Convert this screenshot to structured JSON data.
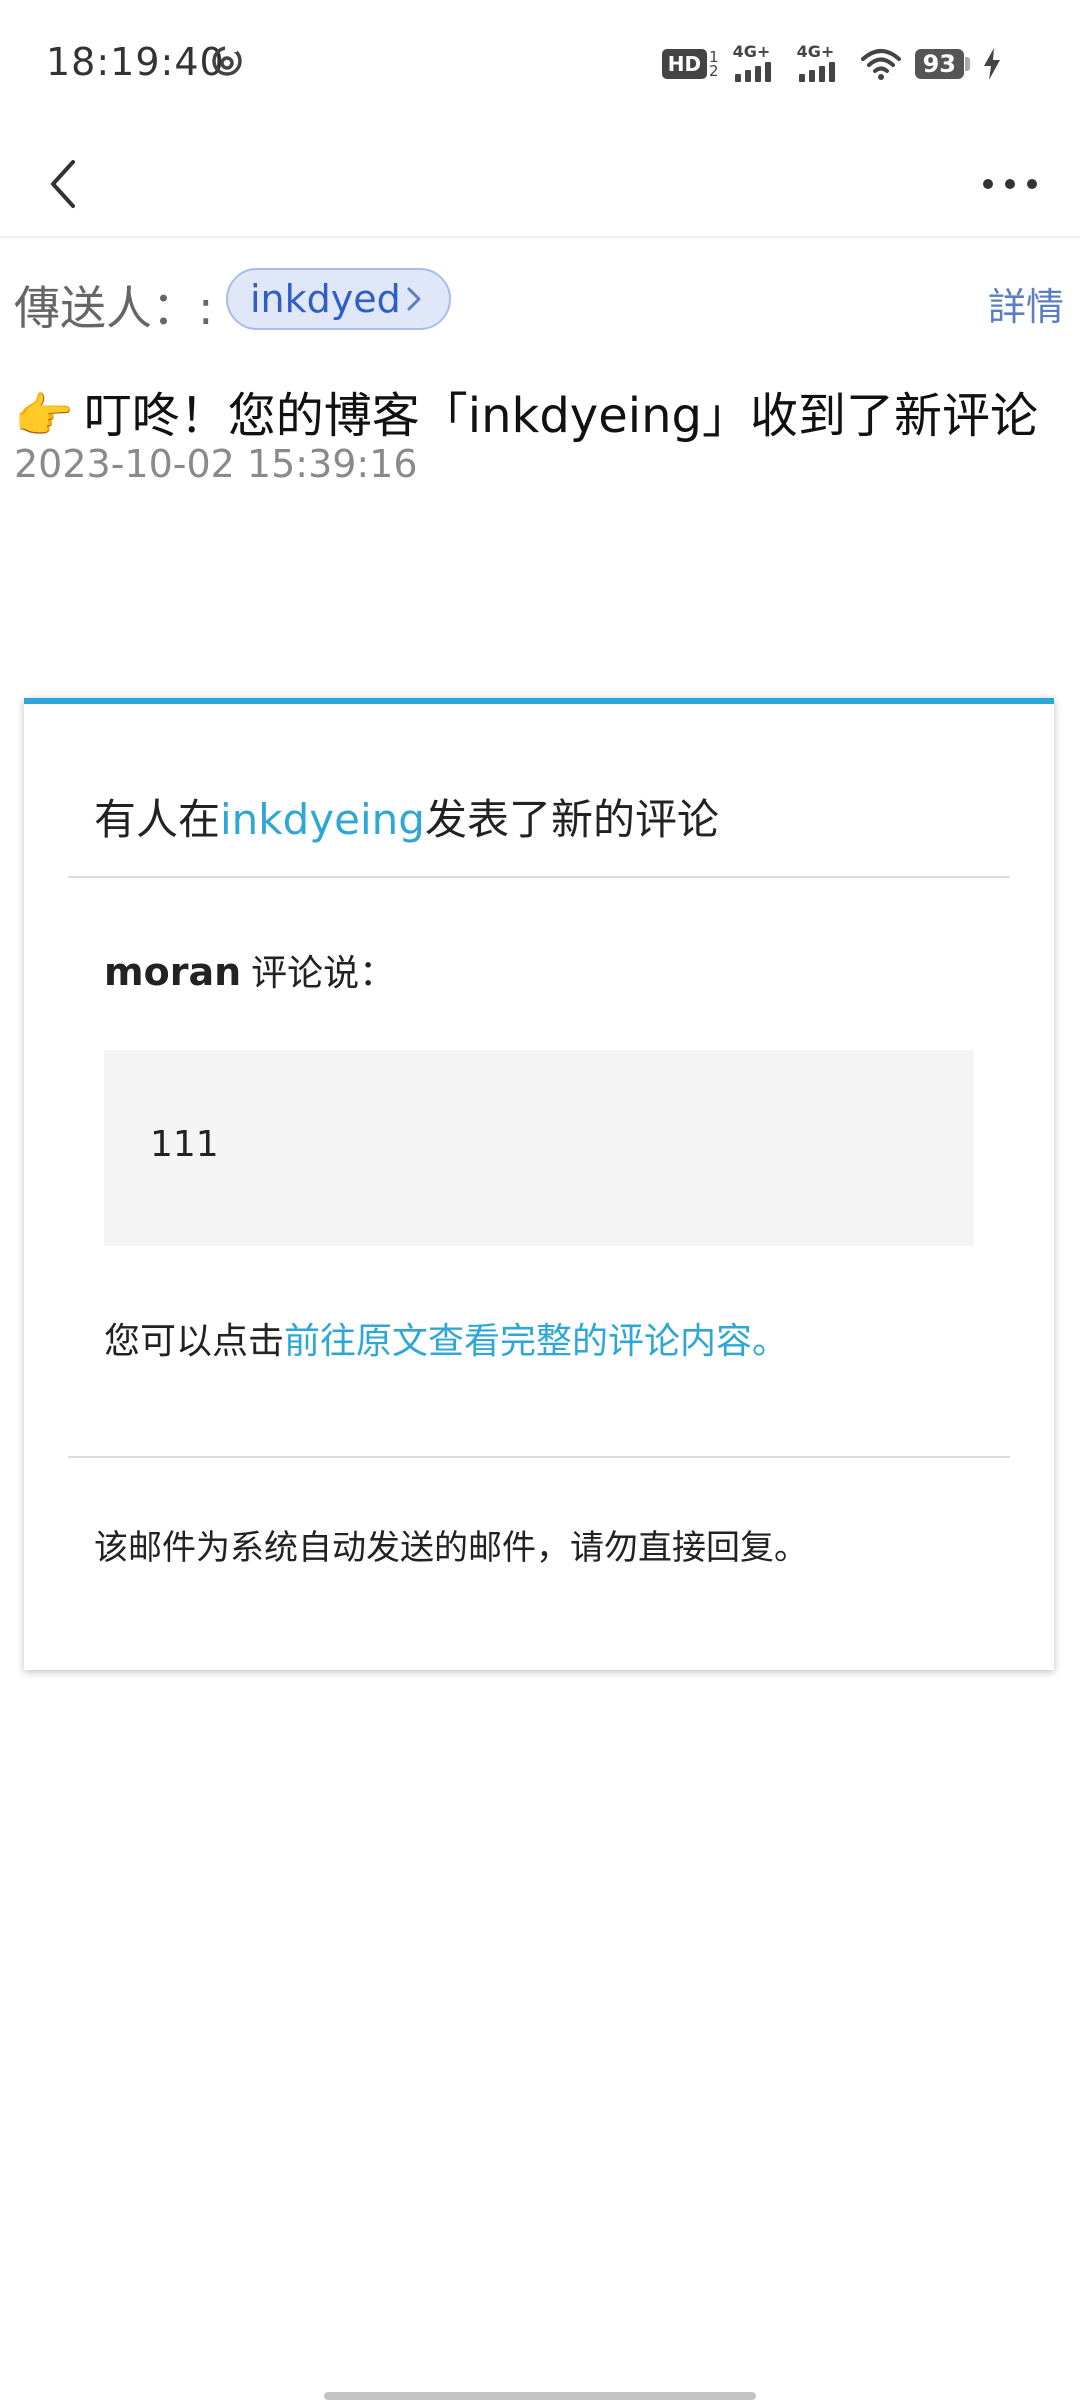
{
  "status_bar": {
    "time": "18:19:40",
    "hd_label": "HD",
    "hd_sub_top": "1",
    "hd_sub_bottom": "2",
    "net1_label": "4G+",
    "net2_label": "4G+",
    "battery_level": "93",
    "icons": [
      "sync-icon",
      "hd-icon",
      "signal-icon",
      "wifi-icon",
      "battery-icon",
      "charging-icon"
    ]
  },
  "app_bar": {
    "back_icon": "chevron-left-icon",
    "more_icon": "more-horizontal-icon"
  },
  "sender": {
    "label": "傳送人：:",
    "name": "inkdyed",
    "details_label": "詳情"
  },
  "subject": {
    "emoji": "👉",
    "text": "叮咚！您的博客「inkdyeing」收到了新评论"
  },
  "date": "2023-10-02 15:39:16",
  "email": {
    "accent_color": "#2ea7d6",
    "title_prefix": "有人在",
    "title_blog": "inkdyeing",
    "title_suffix": "发表了新的评论",
    "commenter_name": "moran",
    "commenter_suffix": "评论说：",
    "comment_text": "111",
    "hint_prefix": "您可以点击",
    "hint_link": "前往原文查看完整的评论内容。",
    "footer_note": "该邮件为系统自动发送的邮件，请勿直接回复。"
  }
}
